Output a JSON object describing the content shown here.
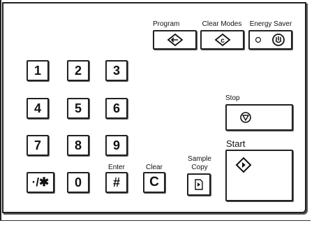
{
  "top_buttons": {
    "program_label": "Program",
    "clear_modes_label": "Clear Modes",
    "energy_saver_label": "Energy Saver"
  },
  "keypad": {
    "keys": [
      "1",
      "2",
      "3",
      "4",
      "5",
      "6",
      "7",
      "8",
      "9",
      "·/✱",
      "0",
      "#"
    ],
    "enter_label": "Enter"
  },
  "clear": {
    "label": "Clear",
    "key": "C"
  },
  "sample_copy": {
    "label_line1": "Sample",
    "label_line2": "Copy"
  },
  "stop": {
    "label": "Stop"
  },
  "start": {
    "label": "Start"
  },
  "icons": {
    "program": "program-icon",
    "clear_modes": "clear-modes-icon",
    "energy_saver": "energy-saver-icon",
    "stop": "stop-icon",
    "start": "start-icon",
    "sample_copy": "sample-copy-icon"
  }
}
